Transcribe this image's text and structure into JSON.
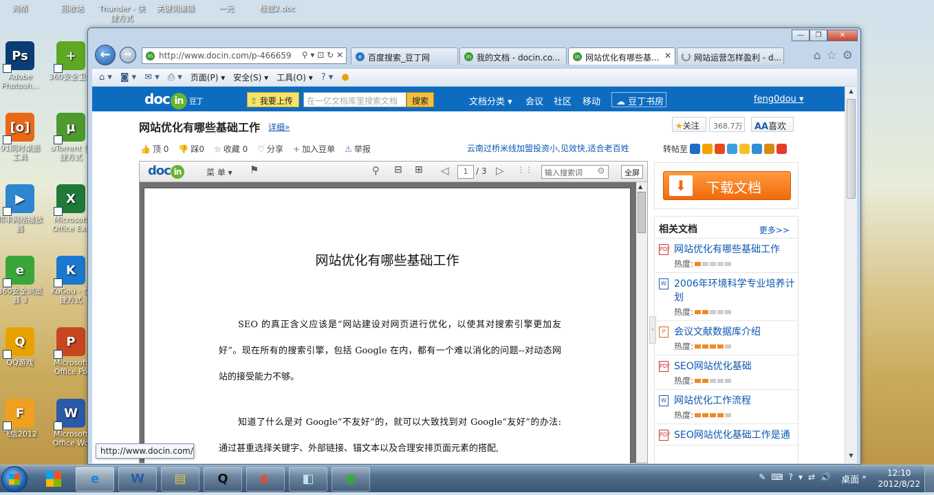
{
  "desktop": {
    "top_labels": [
      "网络",
      "回收站",
      "Thunder - 快捷方式",
      "关键词编辑",
      "一元",
      "标题2.doc"
    ],
    "icons": [
      {
        "label": "Adobe Photosh...",
        "glyph": "Ps",
        "color": "#0a3d73"
      },
      {
        "label": "360安全卫士",
        "glyph": "+",
        "color": "#5ea823"
      },
      {
        "label": "91同时桌面工具",
        "glyph": "[o]",
        "color": "#e66a1a"
      },
      {
        "label": "uTorrent 快捷方式",
        "glyph": "µ",
        "color": "#4d9b2f"
      },
      {
        "label": "邦丰网络播放器",
        "glyph": "▶",
        "color": "#2d86d0"
      },
      {
        "label": "Microsoft Office Exc",
        "glyph": "X",
        "color": "#1f7a3a"
      },
      {
        "label": "360安全浏览器 3",
        "glyph": "e",
        "color": "#3aa63a"
      },
      {
        "label": "KuGou - 快捷方式",
        "glyph": "K",
        "color": "#1b78d0"
      },
      {
        "label": "QQ游戏",
        "glyph": "Q",
        "color": "#e8a200"
      },
      {
        "label": "Microsoft Office Po",
        "glyph": "P",
        "color": "#c8461f"
      },
      {
        "label": "飞信2012",
        "glyph": "F",
        "color": "#f0a020"
      },
      {
        "label": "Microsoft Office Wo",
        "glyph": "W",
        "color": "#2a5aa8"
      }
    ]
  },
  "browser": {
    "window_buttons": {
      "minimize": "—",
      "restore": "❐",
      "close": "✕"
    },
    "back_glyph": "←",
    "forward_glyph": "→",
    "url": "http://www.docin.com/p-466659",
    "url_tools": "⚲ ▾ ⊡ ↻ ✕",
    "tabs": [
      {
        "label": "百度搜索_豆丁网",
        "icon": "ie-icon"
      },
      {
        "label": "我的文档 - docin.co...",
        "icon": "docin-icon"
      },
      {
        "label": "网站优化有哪些基...",
        "icon": "docin-icon",
        "active": true,
        "close": "✕"
      },
      {
        "label": "网站运营怎样盈利 - d...",
        "icon": "loading-icon"
      }
    ],
    "right_tools": [
      "⌂",
      "☆",
      "⚙"
    ],
    "commandbar": {
      "page": "页面(P)",
      "safety": "安全(S)",
      "tools": "工具(O)",
      "help": "?"
    }
  },
  "docin": {
    "logo": "doc",
    "logo_in": "in",
    "logo_cn": "豆丁",
    "upload": "我要上传",
    "search_placeholder": "在一亿文档库里搜索文档",
    "search_btn": "搜索",
    "menu": {
      "category": "文档分类",
      "meeting": "会议",
      "community": "社区",
      "mobile": "移动"
    },
    "bookroom": "豆丁书房",
    "user": "feng0dou",
    "doc_title": "网站优化有哪些基础工作",
    "detail": "详细»",
    "follow": "关注",
    "follow_count": "368.7万",
    "like": "喜欢",
    "actions": [
      {
        "glyph": "👍",
        "label": "顶 0"
      },
      {
        "glyph": "👎",
        "label": "踩0"
      },
      {
        "glyph": "☆",
        "label": "收藏 0"
      },
      {
        "glyph": "♡",
        "label": "分享"
      },
      {
        "glyph": "+",
        "label": "加入豆单"
      },
      {
        "glyph": "⚠",
        "label": "举报"
      }
    ],
    "ad": "云南过桥米线加盟投资小,见效快,适合老百姓",
    "share_label": "转帖至",
    "share_colors": [
      "#1d6cc9",
      "#f4a300",
      "#e94a1a",
      "#3aa0e0",
      "#f5c028",
      "#2f8fd8",
      "#d98a10",
      "#e83a2a"
    ]
  },
  "viewer": {
    "logo": "doc",
    "logo_in": "in",
    "menu": "菜 单",
    "page_current": "1",
    "page_total": "/ 3",
    "search_placeholder": "输入搜索词",
    "fullscreen": "全屏",
    "title": "网站优化有哪些基础工作",
    "paragraphs": [
      "SEO 的真正含义应该是“网站建设对网页进行优化，以使其对搜索引擎更加友好”。现在所有的搜索引擎，包括 Google 在内，都有一个难以消化的问题--对动态网站的接受能力不够。",
      "知道了什么是对 Google“不友好”的，就可以大致找到对 Google“友好”的办法: 通过甚重选择关键字、外部链接、锚文本以及合理安排页面元素的搭配,"
    ]
  },
  "sidebar": {
    "download": "下载文档",
    "related_title": "相关文档",
    "more": "更多>>",
    "heat_label": "热度:",
    "items": [
      {
        "title": "网站优化有哪些基础工作",
        "type": "PDF",
        "heat": 1
      },
      {
        "title": "2006年环境科学专业培养计划",
        "type": "W",
        "heat": 2
      },
      {
        "title": "会议文献数据库介绍",
        "type": "P",
        "heat": 4
      },
      {
        "title": "SEO网站优化基础",
        "type": "PDF",
        "heat": 2
      },
      {
        "title": "网站优化工作流程",
        "type": "W",
        "heat": 4
      },
      {
        "title": "SEO网站优化基础工作是通",
        "type": "PDF",
        "heat": 2
      }
    ]
  },
  "status_tip": "http://www.docin.com/",
  "taskbar": {
    "apps": [
      {
        "name": "ie",
        "glyph": "e"
      },
      {
        "name": "word",
        "glyph": "W"
      },
      {
        "name": "explorer",
        "glyph": "▤"
      },
      {
        "name": "qq",
        "glyph": "Q"
      },
      {
        "name": "media",
        "glyph": "◐"
      },
      {
        "name": "notes",
        "glyph": "◧"
      },
      {
        "name": "monitor",
        "glyph": "▣"
      }
    ],
    "tray": [
      "✎",
      "⌨",
      "?",
      "▾",
      "⇄",
      "🔊"
    ],
    "desktop_label": "桌面",
    "expand": "»",
    "time": "12:10",
    "date": "2012/8/22"
  }
}
